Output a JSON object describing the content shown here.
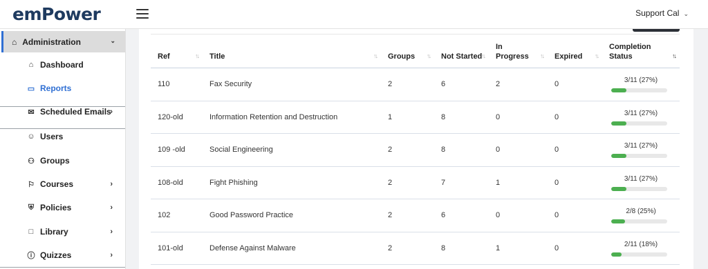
{
  "app": {
    "logo_text": "emPower",
    "user_menu_label": "Support Cal"
  },
  "sidebar": {
    "section_label": "Administration",
    "items": [
      {
        "label": "Dashboard",
        "icon": "home-outline-icon",
        "active": false,
        "has_children": false
      },
      {
        "label": "Reports",
        "icon": "monitor-icon",
        "active": true,
        "has_children": false
      },
      {
        "label": "Scheduled Emails",
        "icon": "envelope-open-icon",
        "active": false,
        "has_children": true
      },
      {
        "label": "Users",
        "icon": "user-icon",
        "active": false,
        "has_children": false
      },
      {
        "label": "Groups",
        "icon": "users-icon",
        "active": false,
        "has_children": false
      },
      {
        "label": "Courses",
        "icon": "award-icon",
        "active": false,
        "has_children": true
      },
      {
        "label": "Policies",
        "icon": "shield-icon",
        "active": false,
        "has_children": true
      },
      {
        "label": "Library",
        "icon": "folder-icon",
        "active": false,
        "has_children": true
      },
      {
        "label": "Quizzes",
        "icon": "question-circle-icon",
        "active": false,
        "has_children": true
      }
    ]
  },
  "table": {
    "columns": [
      "Ref",
      "Title",
      "Groups",
      "Not Started",
      "In Progress",
      "Expired",
      "Completion Status"
    ],
    "sorted_column": "Completion Status",
    "accent_color": "#4caf50",
    "rows": [
      {
        "ref": "110",
        "title": "Fax Security",
        "groups": "2",
        "not_started": "6",
        "in_progress": "2",
        "expired": "0",
        "completion": "3/11 (27%)",
        "completion_fraction": 0.27
      },
      {
        "ref": "120-old",
        "title": "Information Retention and Destruction",
        "groups": "1",
        "not_started": "8",
        "in_progress": "0",
        "expired": "0",
        "completion": "3/11 (27%)",
        "completion_fraction": 0.27
      },
      {
        "ref": "109 -old",
        "title": "Social Engineering",
        "groups": "2",
        "not_started": "8",
        "in_progress": "0",
        "expired": "0",
        "completion": "3/11 (27%)",
        "completion_fraction": 0.27
      },
      {
        "ref": "108-old",
        "title": "Fight Phishing",
        "groups": "2",
        "not_started": "7",
        "in_progress": "1",
        "expired": "0",
        "completion": "3/11 (27%)",
        "completion_fraction": 0.27
      },
      {
        "ref": "102",
        "title": "Good Password Practice",
        "groups": "2",
        "not_started": "6",
        "in_progress": "0",
        "expired": "0",
        "completion": "2/8 (25%)",
        "completion_fraction": 0.25
      },
      {
        "ref": "101-old",
        "title": "Defense Against Malware",
        "groups": "2",
        "not_started": "8",
        "in_progress": "1",
        "expired": "0",
        "completion": "2/11 (18%)",
        "completion_fraction": 0.18
      }
    ]
  }
}
